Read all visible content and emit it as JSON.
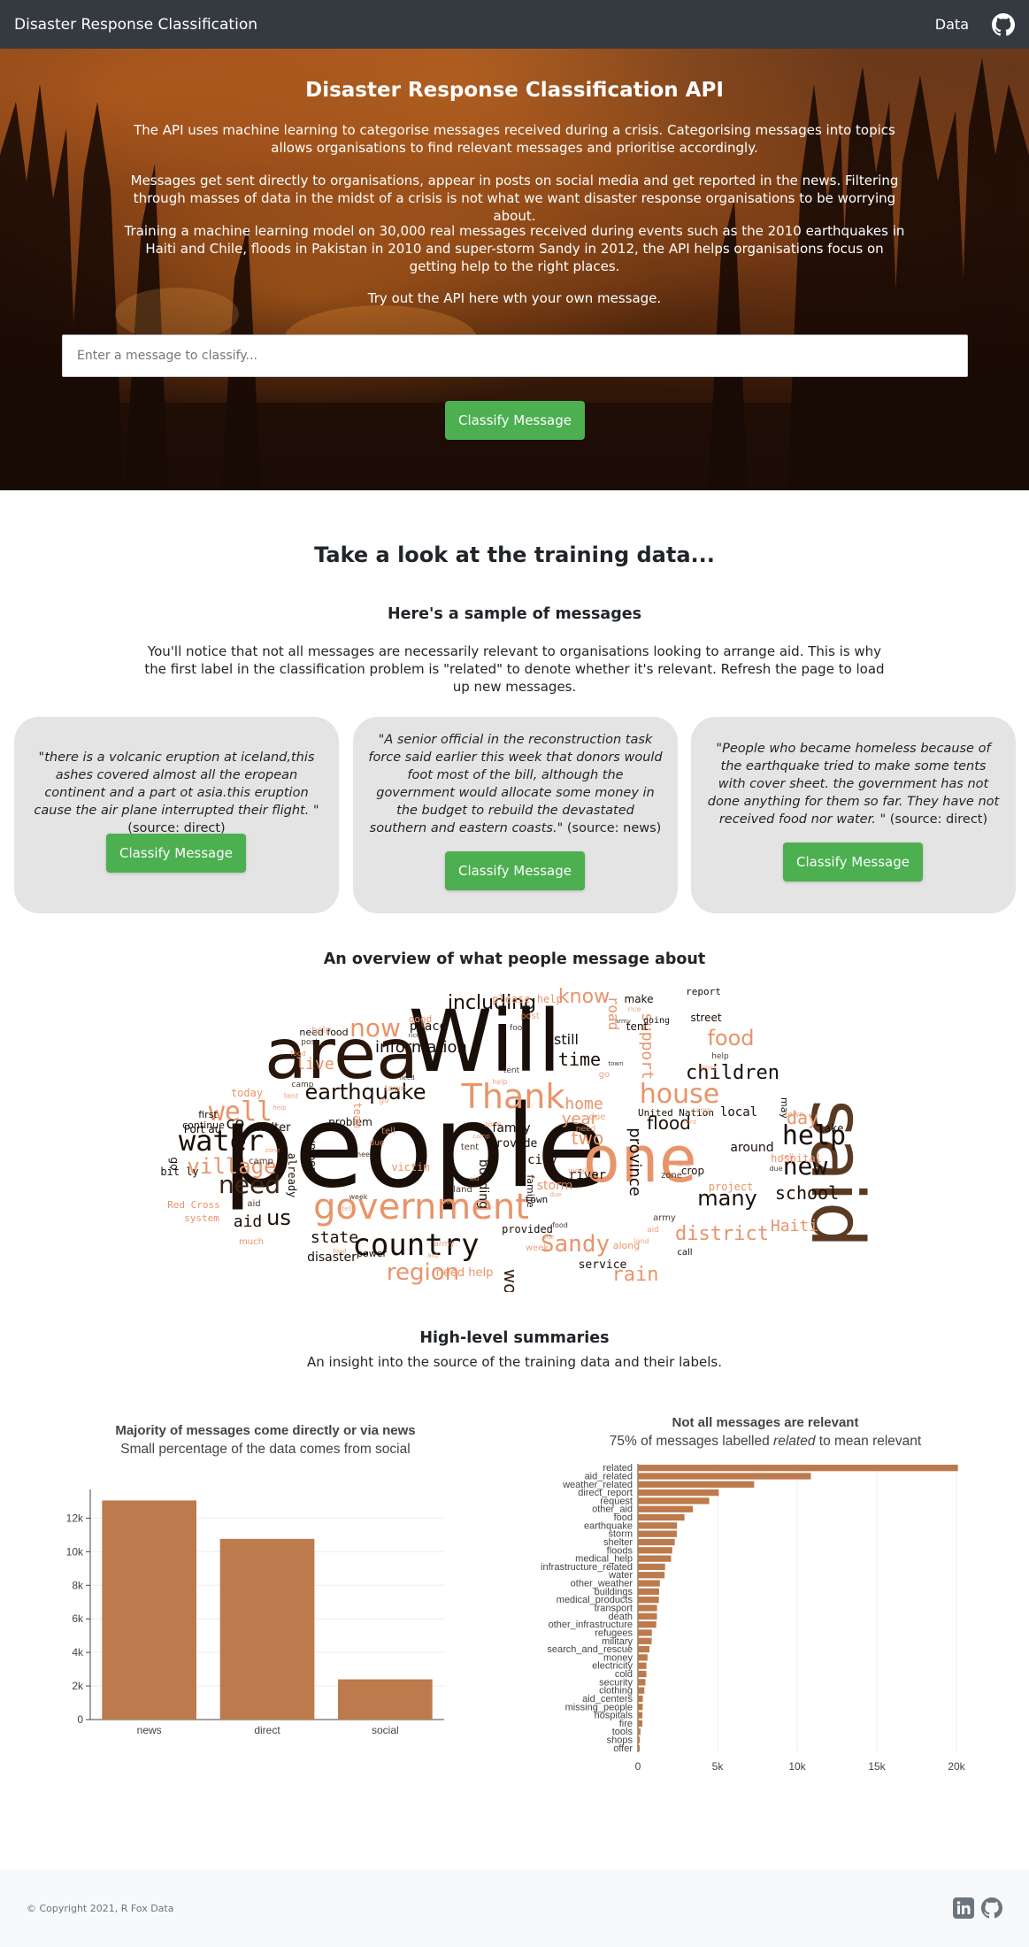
{
  "nav": {
    "brand": "Disaster Response Classification",
    "data_link": "Data",
    "github_icon": "github-icon"
  },
  "hero": {
    "title": "Disaster Response Classification API",
    "p1": "The API uses machine learning to categorise messages received during a crisis. Categorising messages into topics allows organisations to find relevant messages and prioritise accordingly.",
    "p2": "Messages get sent directly to organisations, appear in posts on social media and get reported in the news. Filtering through masses of data in the midst of a crisis is not what we want disaster response organisations to be worrying about.",
    "p3": "Training a machine learning model on 30,000 real messages received during events such as the 2010 earthquakes in Haiti and Chile, floods in Pakistan in 2010 and super-storm Sandy in 2012, the API helps organisations focus on getting help to the right places.",
    "p4": "Try out the API here wth your own message.",
    "input_placeholder": "Enter a message to classify...",
    "button": "Classify Message"
  },
  "training": {
    "heading": "Take a look at the training data...",
    "sample_heading": "Here's a sample of messages",
    "sample_intro": "You'll notice that not all messages are necessarily relevant to organisations looking to arrange aid. This is why the first label in the classification problem is \"related\" to denote whether it's relevant. Refresh the page to load up new messages.",
    "cards": [
      {
        "quote": "\"there is a volcanic eruption at iceland,this ashes covered almost all the eropean continent and a part ot asia.this eruption cause the air plane interrupted their flight. \"",
        "source": "(source: direct)",
        "button": "Classify Message"
      },
      {
        "quote": "\"A senior official in the reconstruction task force said earlier this week that donors would foot most of the bill, although the government would allocate some money in the budget to rebuild the devastated southern and eastern coasts.\"",
        "source": "(source: news)",
        "button": "Classify Message"
      },
      {
        "quote": "\"People who became homeless because of the earthquake tried to make some tents with cover sheet. the government has not done anything for them so far. They have not received food nor water. \"",
        "source": "(source: direct)",
        "button": "Classify Message"
      }
    ],
    "overview_heading": "An overview of what people message about"
  },
  "wordcloud": [
    {
      "w": "people",
      "c": "#1a0f08"
    },
    {
      "w": "Will",
      "c": "#1a0f08"
    },
    {
      "w": "area",
      "c": "#2a170b"
    },
    {
      "w": "said",
      "c": "#5a3a22"
    },
    {
      "w": "one",
      "c": "#e8946a"
    },
    {
      "w": "government",
      "c": "#e8946a"
    },
    {
      "w": "country",
      "c": "#1a0f08"
    },
    {
      "w": "Thank",
      "c": "#e8946a"
    },
    {
      "w": "water",
      "c": "#1a0f08"
    },
    {
      "w": "house",
      "c": "#e8946a"
    },
    {
      "w": "help",
      "c": "#1a0f08"
    },
    {
      "w": "need",
      "c": "#3b2414"
    },
    {
      "w": "well",
      "c": "#e8946a"
    },
    {
      "w": "now",
      "c": "#e8946a"
    },
    {
      "w": "new",
      "c": "#1a0f08"
    },
    {
      "w": "earthquake",
      "c": "#1a0f08"
    },
    {
      "w": "village",
      "c": "#e8946a"
    },
    {
      "w": "region",
      "c": "#e8946a"
    },
    {
      "w": "Sandy",
      "c": "#e8946a"
    },
    {
      "w": "food",
      "c": "#e8946a"
    },
    {
      "w": "children",
      "c": "#1a0f08"
    },
    {
      "w": "including",
      "c": "#1a0f08"
    },
    {
      "w": "district",
      "c": "#e8946a"
    },
    {
      "w": "many",
      "c": "#1a0f08"
    },
    {
      "w": "school",
      "c": "#1a0f08"
    },
    {
      "w": "know",
      "c": "#e8946a"
    },
    {
      "w": "time",
      "c": "#1a0f08"
    },
    {
      "w": "us",
      "c": "#1a0f08"
    },
    {
      "w": "rain",
      "c": "#e8946a"
    },
    {
      "w": "flood",
      "c": "#1a0f08"
    },
    {
      "w": "day",
      "c": "#e8946a"
    },
    {
      "w": "work",
      "c": "#3b2414"
    },
    {
      "w": "state",
      "c": "#1a0f08"
    },
    {
      "w": "information",
      "c": "#1a0f08"
    },
    {
      "w": "home",
      "c": "#e8946a"
    },
    {
      "w": "two",
      "c": "#e8946a"
    },
    {
      "w": "Haiti",
      "c": "#e8946a"
    },
    {
      "w": "year",
      "c": "#e8946a"
    },
    {
      "w": "support",
      "c": "#e8946a"
    },
    {
      "w": "province",
      "c": "#1a0f08"
    },
    {
      "w": "live",
      "c": "#e8946a"
    },
    {
      "w": "co",
      "c": "#1a0f08"
    },
    {
      "w": "aid",
      "c": "#1a0f08"
    },
    {
      "w": "family",
      "c": "#1a0f08"
    },
    {
      "w": "city",
      "c": "#1a0f08"
    },
    {
      "w": "around",
      "c": "#1a0f08"
    },
    {
      "w": "local",
      "c": "#1a0f08"
    },
    {
      "w": "still",
      "c": "#1a0f08"
    },
    {
      "w": "road",
      "c": "#e8946a"
    },
    {
      "w": "building",
      "c": "#1a0f08"
    },
    {
      "w": "service",
      "c": "#1a0f08"
    },
    {
      "w": "disaster",
      "c": "#1a0f08"
    },
    {
      "w": "place",
      "c": "#1a0f08"
    },
    {
      "w": "shelter",
      "c": "#1a0f08"
    },
    {
      "w": "river",
      "c": "#1a0f08"
    },
    {
      "w": "storm",
      "c": "#e8946a"
    },
    {
      "w": "victim",
      "c": "#e8946a"
    },
    {
      "w": "crop",
      "c": "#1a0f08"
    },
    {
      "w": "already",
      "c": "#1a0f08"
    },
    {
      "w": "problem",
      "c": "#1a0f08"
    },
    {
      "w": "provide",
      "c": "#1a0f08"
    },
    {
      "w": "need help",
      "c": "#e8946a"
    },
    {
      "w": "please help",
      "c": "#e8946a"
    },
    {
      "w": "street",
      "c": "#1a0f08"
    },
    {
      "w": "report",
      "c": "#1a0f08"
    },
    {
      "w": "make",
      "c": "#1a0f08"
    },
    {
      "w": "hospital",
      "c": "#e8946a"
    },
    {
      "w": "number",
      "c": "#1a0f08"
    },
    {
      "w": "today",
      "c": "#e8946a"
    },
    {
      "w": "Port au",
      "c": "#1a0f08"
    },
    {
      "w": "bit ly",
      "c": "#1a0f08"
    },
    {
      "w": "go",
      "c": "#1a0f08"
    },
    {
      "w": "United Nation",
      "c": "#1a0f08"
    },
    {
      "w": "tent",
      "c": "#1a0f08"
    },
    {
      "w": "take",
      "c": "#1a0f08"
    },
    {
      "w": "first",
      "c": "#1a0f08"
    },
    {
      "w": "provided",
      "c": "#1a0f08"
    },
    {
      "w": "familie",
      "c": "#1a0f08"
    },
    {
      "w": "project",
      "c": "#e8946a"
    },
    {
      "w": "need food",
      "c": "#1a0f08"
    },
    {
      "w": "good",
      "c": "#e8946a"
    },
    {
      "w": "continue",
      "c": "#1a0f08"
    },
    {
      "w": "Red Cross",
      "c": "#e8946a"
    },
    {
      "w": "much",
      "c": "#e8946a"
    },
    {
      "w": "town",
      "c": "#1a0f08"
    },
    {
      "w": "call",
      "c": "#1a0f08"
    },
    {
      "w": "going",
      "c": "#1a0f08"
    },
    {
      "w": "power",
      "c": "#1a0f08"
    },
    {
      "w": "system",
      "c": "#e8946a"
    },
    {
      "w": "along",
      "c": "#e8946a"
    },
    {
      "w": "team",
      "c": "#e8946a"
    },
    {
      "w": "may",
      "c": "#1a0f08"
    },
    {
      "w": "say",
      "c": "#e8946a"
    }
  ],
  "summaries": {
    "heading": "High-level summaries",
    "subheading": "An insight into the source of the training data and their labels."
  },
  "chart_data": [
    {
      "type": "bar",
      "title": "Majority of messages come directly or via news",
      "subtitle": "Small percentage of the data comes from social",
      "categories": [
        "news",
        "direct",
        "social"
      ],
      "values": [
        13054,
        10766,
        2396
      ],
      "ylim": [
        0,
        13500
      ],
      "yticks": [
        0,
        2000,
        4000,
        6000,
        8000,
        10000,
        12000
      ],
      "yticklabels": [
        "0",
        "2k",
        "4k",
        "6k",
        "8k",
        "10k",
        "12k"
      ],
      "color": "#bd7a4c",
      "grid": true
    },
    {
      "type": "bar",
      "orientation": "horizontal",
      "title": "Not all messages are relevant",
      "subtitle_parts": [
        "75% of messages labelled ",
        "related",
        " to mean relevant"
      ],
      "categories": [
        "related",
        "aid_related",
        "weather_related",
        "direct_report",
        "request",
        "other_aid",
        "food",
        "earthquake",
        "storm",
        "shelter",
        "floods",
        "medical_help",
        "infrastructure_related",
        "water",
        "other_weather",
        "buildings",
        "medical_products",
        "transport",
        "death",
        "other_infrastructure",
        "refugees",
        "military",
        "search_and_rescue",
        "money",
        "electricity",
        "cold",
        "security",
        "clothing",
        "aid_centers",
        "missing_people",
        "hospitals",
        "fire",
        "tools",
        "shops",
        "offer"
      ],
      "values": [
        20093,
        10860,
        7297,
        5075,
        4474,
        3446,
        2923,
        2455,
        2443,
        2314,
        2155,
        2084,
        1705,
        1672,
        1376,
        1333,
        1313,
        1201,
        1194,
        1151,
        875,
        860,
        724,
        604,
        532,
        530,
        471,
        405,
        309,
        298,
        283,
        282,
        159,
        120,
        118
      ],
      "xlim": [
        0,
        20500
      ],
      "xticks": [
        0,
        5000,
        10000,
        15000,
        20000
      ],
      "xticklabels": [
        "0",
        "5k",
        "10k",
        "15k",
        "20k"
      ],
      "color": "#bd7a4c",
      "grid": true
    }
  ],
  "footer": {
    "copyright": "© Copyright 2021, R Fox Data",
    "linkedin_icon": "linkedin-icon",
    "github_icon": "github-icon"
  }
}
